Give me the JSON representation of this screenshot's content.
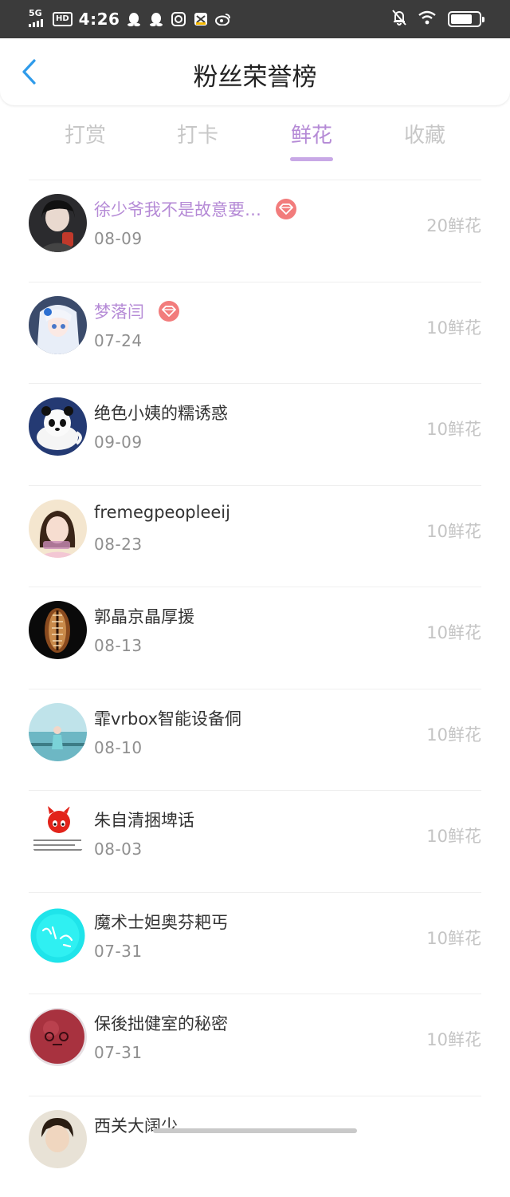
{
  "status_bar": {
    "network": "5G",
    "hd": "HD",
    "time": "4:26",
    "battery_level": 0.75,
    "left_icons": [
      "qq-icon",
      "qq-icon",
      "camera-app-icon",
      "capcut-icon",
      "weibo-icon"
    ],
    "right_icons": [
      "mute-bell-icon",
      "wifi-icon",
      "battery-icon"
    ]
  },
  "header": {
    "title": "粉丝荣誉榜"
  },
  "tabs": [
    {
      "label": "打赏",
      "active": false
    },
    {
      "label": "打卡",
      "active": false
    },
    {
      "label": "鲜花",
      "active": true
    },
    {
      "label": "收藏",
      "active": false
    }
  ],
  "fans": [
    {
      "name": "徐少爷我不是故意要…",
      "date": "08-09",
      "amount": "20鲜花",
      "vip": true,
      "avatar": "avatar-dark-portrait"
    },
    {
      "name": "梦落闫",
      "date": "07-24",
      "amount": "10鲜花",
      "vip": true,
      "avatar": "avatar-anime-girl"
    },
    {
      "name": "绝色小姨的糯诱惑",
      "date": "09-09",
      "amount": "10鲜花",
      "vip": false,
      "avatar": "avatar-panda-cup"
    },
    {
      "name": "fremegpeopleeij",
      "date": "08-23",
      "amount": "10鲜花",
      "vip": false,
      "avatar": "avatar-girl-photo"
    },
    {
      "name": "郭晶京晶厚援",
      "date": "08-13",
      "amount": "10鲜花",
      "vip": false,
      "avatar": "avatar-shell"
    },
    {
      "name": "霏vrbox智能设备侗",
      "date": "08-10",
      "amount": "10鲜花",
      "vip": false,
      "avatar": "avatar-seaside"
    },
    {
      "name": "朱自清捆埤话",
      "date": "08-03",
      "amount": "10鲜花",
      "vip": false,
      "avatar": "avatar-red-cat"
    },
    {
      "name": "魔术士妲奥芬耙丐",
      "date": "07-31",
      "amount": "10鲜花",
      "vip": false,
      "avatar": "avatar-cyan-circle"
    },
    {
      "name": "保後拙健室的秘密",
      "date": "07-31",
      "amount": "10鲜花",
      "vip": false,
      "avatar": "avatar-red-ball"
    },
    {
      "name": "西关大阔少",
      "date": "",
      "amount": "",
      "vip": false,
      "avatar": "avatar-boy"
    }
  ],
  "colors": {
    "accent": "#b58ad6",
    "status_bar_bg": "#3b3b3b",
    "back_arrow": "#2f9bea",
    "badge": "#f27c7c",
    "inactive_tab": "#c7c7c7",
    "amount": "#c4c4c4"
  }
}
